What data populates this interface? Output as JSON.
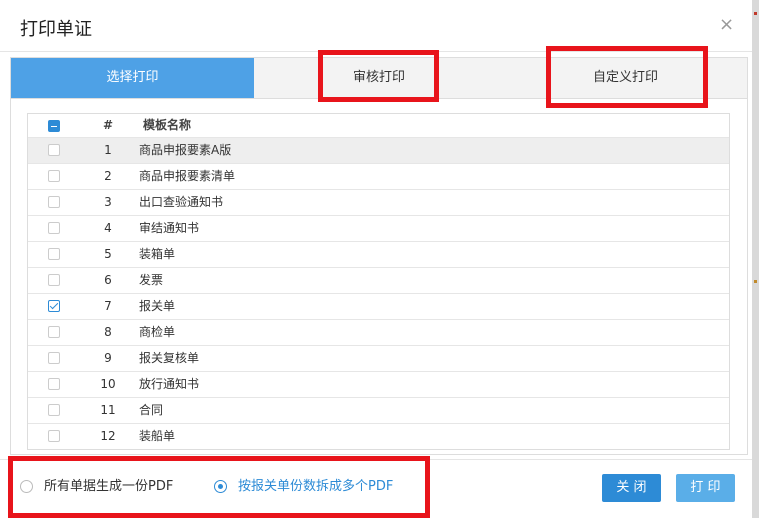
{
  "dialog": {
    "title": "打印单证",
    "close_glyph": "×"
  },
  "tabs": [
    {
      "label": "选择打印",
      "active": true
    },
    {
      "label": "审核打印",
      "active": false
    },
    {
      "label": "自定义打印",
      "active": false
    }
  ],
  "table": {
    "header": {
      "num": "#",
      "name": "模板名称",
      "select_all": "partial"
    },
    "rows": [
      {
        "num": "1",
        "name": "商品申报要素A版",
        "checked": false
      },
      {
        "num": "2",
        "name": "商品申报要素清单",
        "checked": false
      },
      {
        "num": "3",
        "name": "出口查验通知书",
        "checked": false
      },
      {
        "num": "4",
        "name": "审结通知书",
        "checked": false
      },
      {
        "num": "5",
        "name": "装箱单",
        "checked": false
      },
      {
        "num": "6",
        "name": "发票",
        "checked": false
      },
      {
        "num": "7",
        "name": "报关单",
        "checked": true
      },
      {
        "num": "8",
        "name": "商检单",
        "checked": false
      },
      {
        "num": "9",
        "name": "报关复核单",
        "checked": false
      },
      {
        "num": "10",
        "name": "放行通知书",
        "checked": false
      },
      {
        "num": "11",
        "name": "合同",
        "checked": false
      },
      {
        "num": "12",
        "name": "装船单",
        "checked": false
      }
    ]
  },
  "pdf_options": [
    {
      "label": "所有单据生成一份PDF",
      "selected": false
    },
    {
      "label": "按报关单份数拆成多个PDF",
      "selected": true
    }
  ],
  "buttons": {
    "close": "关 闭",
    "print": "打 印"
  },
  "colors": {
    "accent": "#2d8bd6",
    "active_tab": "#4ea1e6",
    "highlight_box": "#e8141b"
  }
}
